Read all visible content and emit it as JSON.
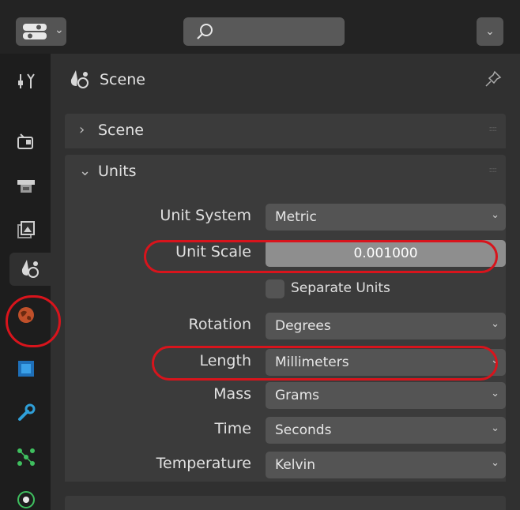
{
  "search": {
    "placeholder": ""
  },
  "context": {
    "title": "Scene"
  },
  "panels": {
    "scene": {
      "label": "Scene"
    },
    "units": {
      "label": "Units"
    }
  },
  "units": {
    "unit_system": {
      "label": "Unit System",
      "value": "Metric"
    },
    "unit_scale": {
      "label": "Unit Scale",
      "value": "0.001000"
    },
    "separate_units": {
      "label": "Separate Units",
      "checked": false
    },
    "rotation": {
      "label": "Rotation",
      "value": "Degrees"
    },
    "length": {
      "label": "Length",
      "value": "Millimeters"
    },
    "mass": {
      "label": "Mass",
      "value": "Grams"
    },
    "time": {
      "label": "Time",
      "value": "Seconds"
    },
    "temperature": {
      "label": "Temperature",
      "value": "Kelvin"
    }
  },
  "tabs": [
    "tool",
    "render",
    "output",
    "view-layer",
    "scene",
    "world",
    "object",
    "modifiers",
    "particles",
    "physics"
  ],
  "active_tab": "scene",
  "colors": {
    "background": "#303030",
    "header": "#232323",
    "tab_strip": "#1d1d1d",
    "panel": "#3b3b3b",
    "field": "#545454",
    "number_field": "#8e8e8e",
    "highlight_annotation": "#d8141c"
  }
}
